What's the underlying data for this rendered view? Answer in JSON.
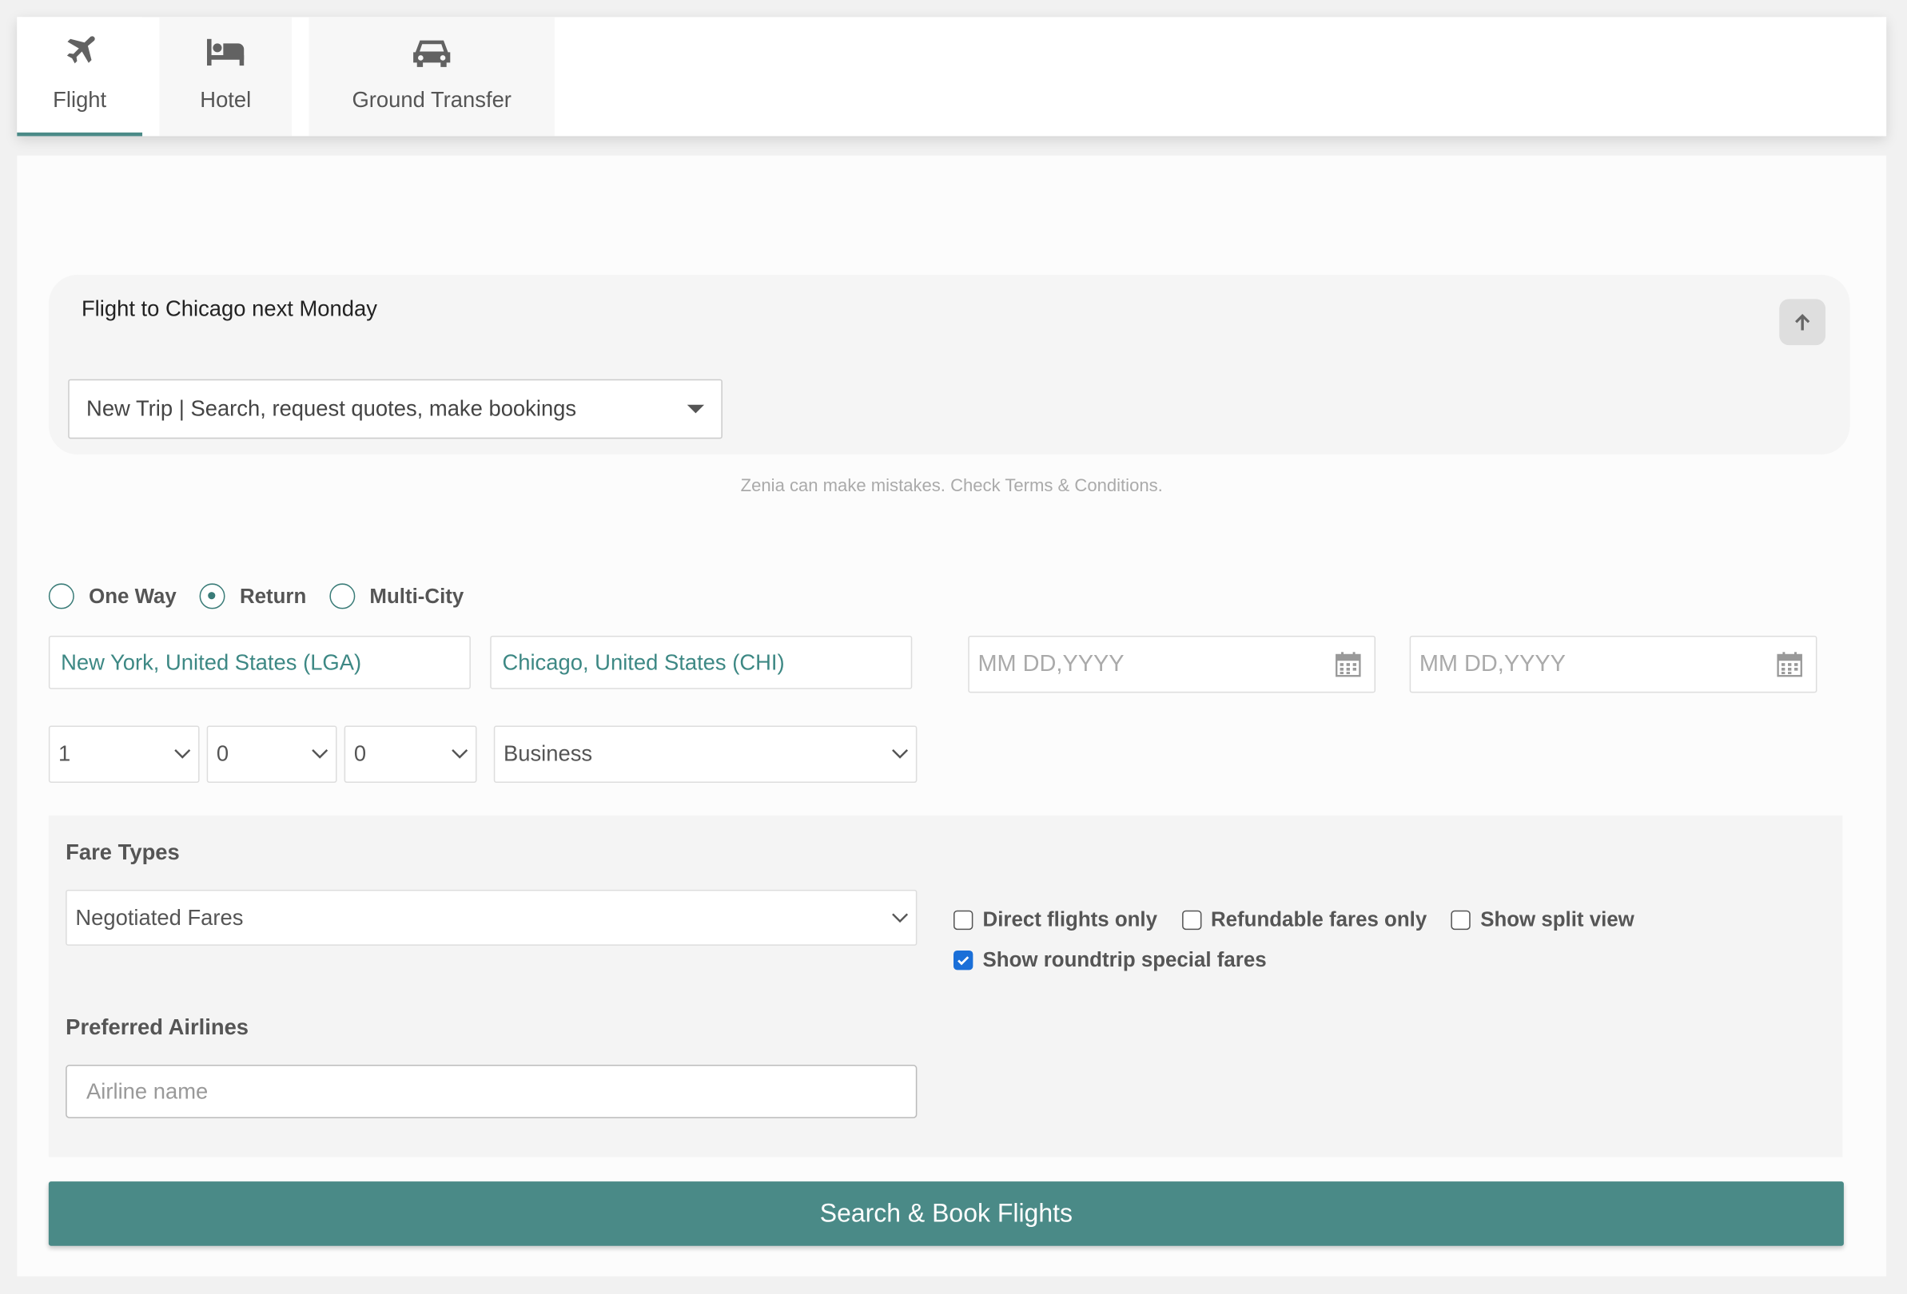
{
  "tabs": [
    {
      "label": "Flight",
      "icon": "airplane-icon",
      "active": true
    },
    {
      "label": "Hotel",
      "icon": "bed-icon",
      "active": false
    },
    {
      "label": "Ground Transfer",
      "icon": "car-icon",
      "active": false
    }
  ],
  "chat": {
    "prompt_text": "Flight to Chicago next Monday",
    "mode_selected": "New Trip | Search, request quotes, make bookings",
    "disclaimer": "Zenia can make mistakes. Check Terms & Conditions."
  },
  "trip_type": {
    "options": [
      "One Way",
      "Return",
      "Multi-City"
    ],
    "selected": "Return"
  },
  "search": {
    "origin": "New York, United States (LGA)",
    "destination": "Chicago, United States (CHI)",
    "depart_date_placeholder": "MM DD,YYYY",
    "return_date_placeholder": "MM DD,YYYY",
    "adults": "1",
    "children": "0",
    "infants": "0",
    "cabin_class": "Business"
  },
  "options": {
    "fare_types_heading": "Fare Types",
    "fare_type_selected": "Negotiated Fares",
    "checkboxes": [
      {
        "label": "Direct flights only",
        "checked": false
      },
      {
        "label": "Refundable fares only",
        "checked": false
      },
      {
        "label": "Show split view",
        "checked": false
      },
      {
        "label": "Show roundtrip special fares",
        "checked": true
      }
    ],
    "preferred_airlines_heading": "Preferred Airlines",
    "airline_placeholder": "Airline name"
  },
  "submit_label": "Search & Book Flights",
  "colors": {
    "accent": "#4a8a87",
    "link_text": "#3d8884",
    "checkbox_checked": "#1a6fd8"
  }
}
